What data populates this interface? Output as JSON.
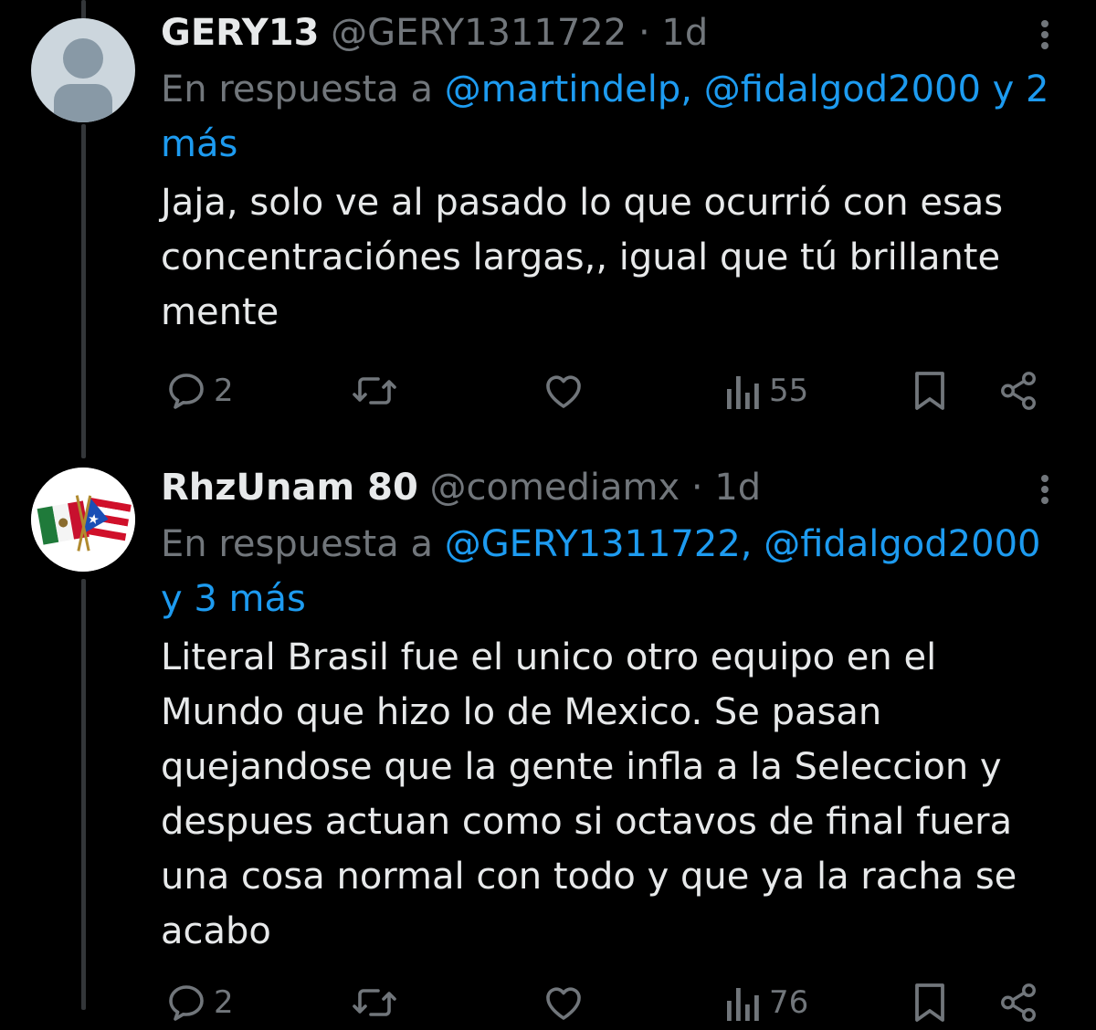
{
  "colors": {
    "background": "#000000",
    "primary_text": "#e7e9ea",
    "secondary_text": "#71767b",
    "accent": "#1d9bf0"
  },
  "tweets": [
    {
      "display_name": "GERY13",
      "handle": "@GERY1311722",
      "separator": "·",
      "time": "1d",
      "reply_prefix": "En respuesta a",
      "reply_mentions": "@martindelp, @fidalgod2000 y 2 más",
      "text": "Jaja, solo ve al pasado lo que ocurrió con esas concentraciónes largas,, igual que tú brillante mente",
      "avatar_icon": "default-profile-avatar",
      "replies": "2",
      "retweets": "",
      "likes": "",
      "views": "55"
    },
    {
      "display_name": "RhzUnam 80",
      "handle": "@comediamx",
      "separator": "·",
      "time": "1d",
      "reply_prefix": "En respuesta a",
      "reply_mentions": "@GERY1311722, @fidalgod2000 y 3 más",
      "text": "Literal Brasil fue el unico otro equipo en el Mundo que hizo lo de Mexico. Se pasan quejandose que la gente infla a la Seleccion y despues actuan como si octavos de final fuera una cosa normal con todo y que ya la racha se acabo",
      "avatar_icon": "mexico-puerto-rico-flags-avatar",
      "replies": "2",
      "retweets": "",
      "likes": "",
      "views": "76"
    }
  ]
}
